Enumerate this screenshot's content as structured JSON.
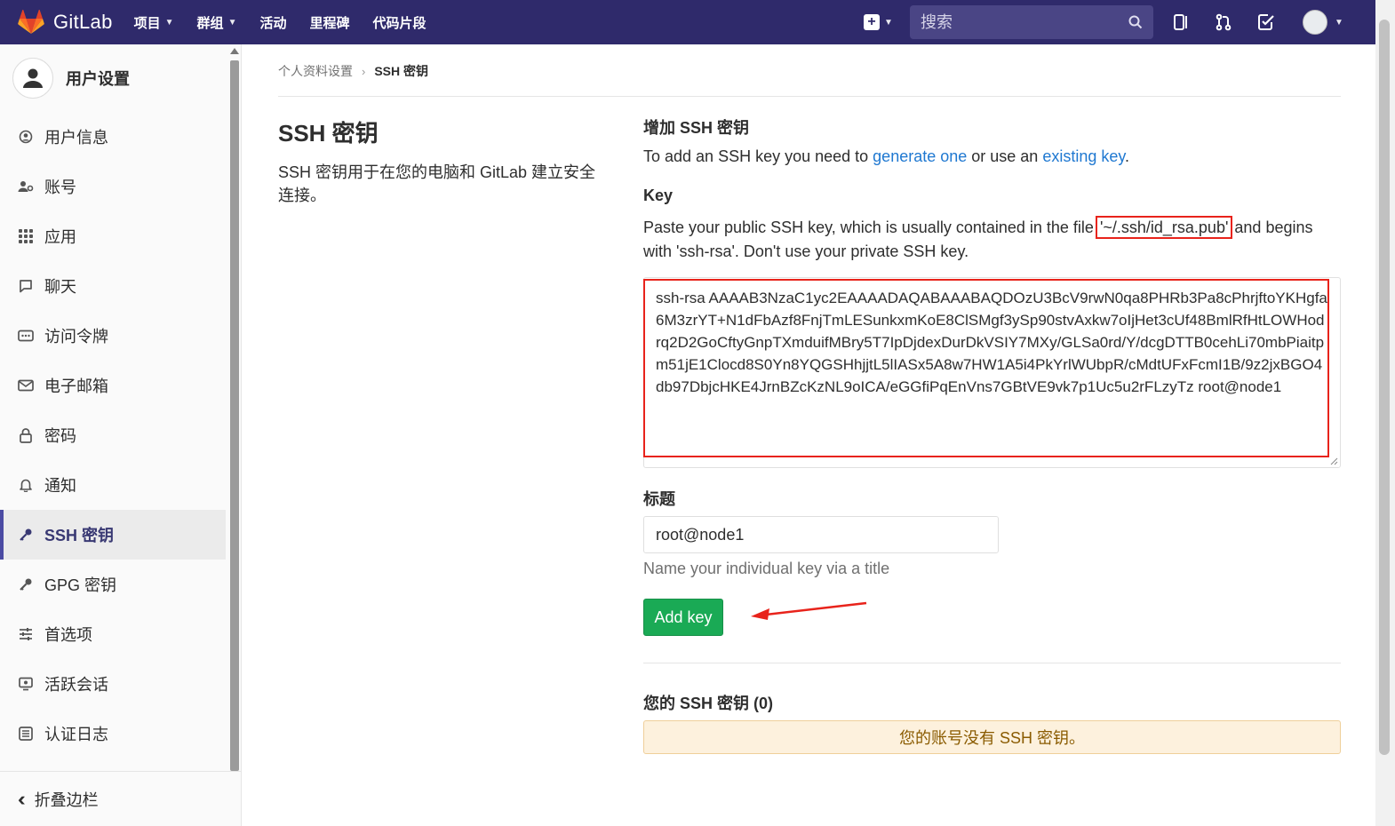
{
  "navbar": {
    "brand": "GitLab",
    "items": [
      {
        "label": "项目",
        "dropdown": true
      },
      {
        "label": "群组",
        "dropdown": true
      },
      {
        "label": "活动",
        "dropdown": false
      },
      {
        "label": "里程碑",
        "dropdown": false
      },
      {
        "label": "代码片段",
        "dropdown": false
      }
    ],
    "search_placeholder": "搜索",
    "icons": [
      "plus-square-icon",
      "search-icon",
      "issues-icon",
      "merge-request-icon",
      "todo-icon",
      "user-avatar"
    ]
  },
  "sidebar": {
    "title": "用户设置",
    "items": [
      {
        "label": "用户信息",
        "icon": "profile-icon"
      },
      {
        "label": "账号",
        "icon": "account-icon"
      },
      {
        "label": "应用",
        "icon": "applications-icon"
      },
      {
        "label": "聊天",
        "icon": "chat-icon"
      },
      {
        "label": "访问令牌",
        "icon": "token-icon"
      },
      {
        "label": "电子邮箱",
        "icon": "mail-icon"
      },
      {
        "label": "密码",
        "icon": "lock-icon"
      },
      {
        "label": "通知",
        "icon": "bell-icon"
      },
      {
        "label": "SSH 密钥",
        "icon": "key-icon",
        "active": true
      },
      {
        "label": "GPG 密钥",
        "icon": "key-icon"
      },
      {
        "label": "首选项",
        "icon": "preferences-icon"
      },
      {
        "label": "活跃会话",
        "icon": "monitor-icon"
      },
      {
        "label": "认证日志",
        "icon": "log-icon"
      }
    ],
    "collapse_label": "折叠边栏"
  },
  "breadcrumb": {
    "parent": "个人资料设置",
    "current": "SSH 密钥"
  },
  "intro": {
    "title": "SSH 密钥",
    "description": "SSH 密钥用于在您的电脑和 GitLab 建立安全连接。"
  },
  "form": {
    "heading": "增加 SSH 密钥",
    "instructions_pre": "To add an SSH key you need to ",
    "link_generate": "generate one",
    "instructions_mid": " or use an ",
    "link_existing": "existing key",
    "instructions_post": ".",
    "key_label": "Key",
    "key_help_pre": "Paste your public SSH key, which is usually contained in the file ",
    "key_help_file": "'~/.ssh/id_rsa.pub'",
    "key_help_post": " and begins with 'ssh-rsa'. Don't use your private SSH key.",
    "key_value": "ssh-rsa AAAAB3NzaC1yc2EAAAADAQABAAABAQDOzU3BcV9rwN0qa8PHRb3Pa8cPhrjftoYKHgfa6M3zrYT+N1dFbAzf8FnjTmLESunkxmKoE8ClSMgf3ySp90stvAxkw7oIjHet3cUf48BmlRfHtLOWHodrq2D2GoCftyGnpTXmduifMBry5T7IpDjdexDurDkVSIY7MXy/GLSa0rd/Y/dcgDTTB0cehLi70mbPiaitpm51jE1Clocd8S0Yn8YQGSHhjjtL5lIASx5A8w7HW1A5i4PkYrlWUbpR/cMdtUFxFcmI1B/9z2jxBGO4db97DbjcHKE4JrnBZcKzNL9oICA/eGGfiPqEnVns7GBtVE9vk7p1Uc5u2rFLzyTz root@node1",
    "title_label": "标题",
    "title_value": "root@node1",
    "title_help": "Name your individual key via a title",
    "submit_label": "Add key"
  },
  "keys": {
    "heading": "您的 SSH 密钥 (0)",
    "empty_message": "您的账号没有 SSH 密钥。"
  },
  "colors": {
    "navbar": "#2f2a6b",
    "link": "#1f78d1",
    "success": "#1aaa55",
    "annotation": "#e8231b",
    "warning_bg": "#fdf1dd"
  }
}
